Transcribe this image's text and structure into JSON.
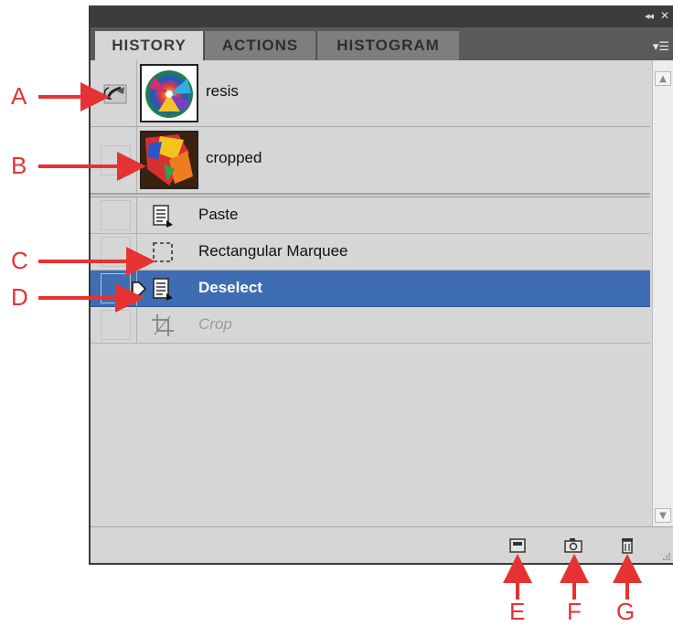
{
  "tabs": [
    {
      "label": "HISTORY",
      "active": true
    },
    {
      "label": "ACTIONS",
      "active": false
    },
    {
      "label": "HISTOGRAM",
      "active": false
    }
  ],
  "snapshots": [
    {
      "label": "resis",
      "history_brush_set": true
    },
    {
      "label": "cropped",
      "history_brush_set": false
    }
  ],
  "steps": [
    {
      "label": "Paste",
      "icon": "document-step-icon",
      "state": "normal"
    },
    {
      "label": "Rectangular Marquee",
      "icon": "rectangular-marquee-icon",
      "state": "normal"
    },
    {
      "label": "Deselect",
      "icon": "document-step-icon",
      "state": "selected"
    },
    {
      "label": "Crop",
      "icon": "crop-icon",
      "state": "undone"
    }
  ],
  "footer_buttons": [
    {
      "name": "new-document-from-state-icon"
    },
    {
      "name": "new-snapshot-icon"
    },
    {
      "name": "delete-state-icon"
    }
  ],
  "callouts": [
    "A",
    "B",
    "C",
    "D",
    "E",
    "F",
    "G"
  ],
  "colors": {
    "callout": "#e53333",
    "selection": "#3e6db4",
    "panel": "#d6d6d6",
    "tabstrip": "#5a5a5a"
  }
}
